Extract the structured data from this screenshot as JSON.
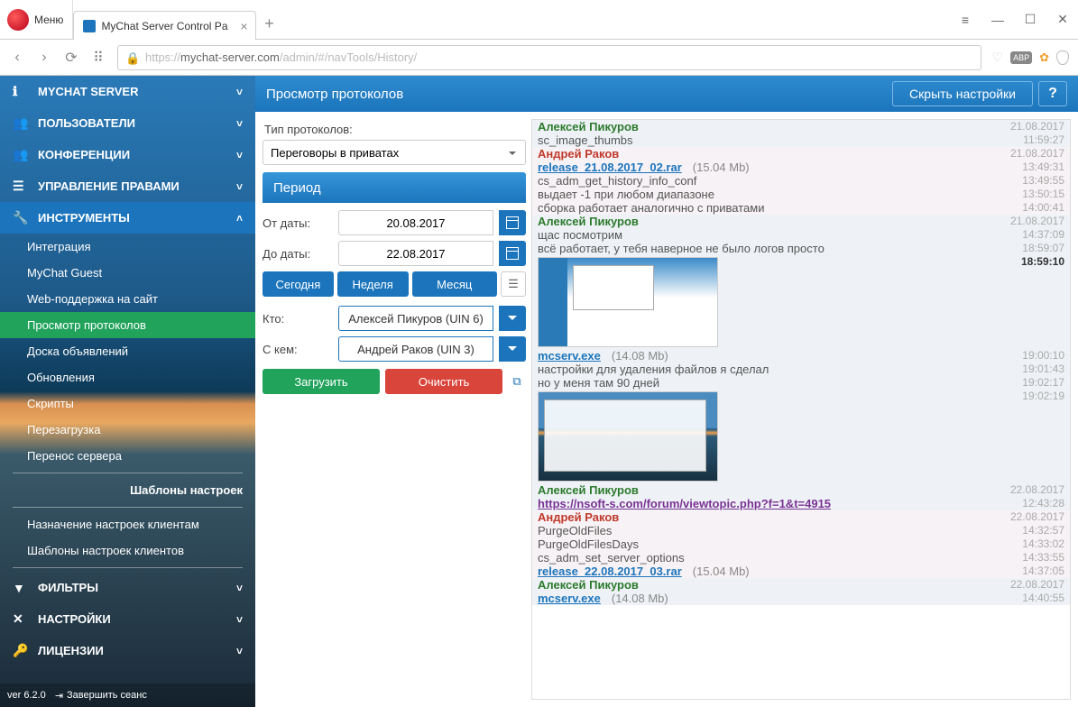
{
  "browser": {
    "menu": "Меню",
    "tab_title": "MyChat Server Control Pa",
    "url_protocol": "https://",
    "url_domain": "mychat-server.com",
    "url_path": "/admin/#/navTools/History/"
  },
  "sidebar": {
    "sections": [
      {
        "label": "MYCHAT SERVER",
        "icon": "ℹ"
      },
      {
        "label": "ПОЛЬЗОВАТЕЛИ",
        "icon": "👥"
      },
      {
        "label": "КОНФЕРЕНЦИИ",
        "icon": "👥"
      },
      {
        "label": "УПРАВЛЕНИЕ ПРАВАМИ",
        "icon": "☰"
      },
      {
        "label": "ИНСТРУМЕНТЫ",
        "icon": "🔧"
      }
    ],
    "tools_items": [
      "Интеграция",
      "MyChat Guest",
      "Web-поддержка на сайт",
      "Просмотр протоколов",
      "Доска объявлений",
      "Обновления",
      "Скрипты",
      "Перезагрузка",
      "Перенос сервера"
    ],
    "templates_header": "Шаблоны настроек",
    "templates_items": [
      "Назначение настроек клиентам",
      "Шаблоны настроек клиентов"
    ],
    "bottom_sections": [
      {
        "label": "ФИЛЬТРЫ",
        "icon": "▼"
      },
      {
        "label": "НАСТРОЙКИ",
        "icon": "✕"
      },
      {
        "label": "ЛИЦЕНЗИИ",
        "icon": "🔑"
      }
    ],
    "version": "ver 6.2.0",
    "logout": "Завершить сеанс"
  },
  "header": {
    "title": "Просмотр протоколов",
    "hide_btn": "Скрыть настройки"
  },
  "settings": {
    "type_label": "Тип протоколов:",
    "type_value": "Переговоры в приватах",
    "period_header": "Период",
    "from_label": "От даты:",
    "from_value": "20.08.2017",
    "to_label": "До даты:",
    "to_value": "22.08.2017",
    "btn_today": "Сегодня",
    "btn_week": "Неделя",
    "btn_month": "Месяц",
    "who_label": "Кто:",
    "who_value": "Алексей Пикуров (UIN 6)",
    "whom_label": "С кем:",
    "whom_value": "Андрей Раков (UIN 3)",
    "btn_load": "Загрузить",
    "btn_clear": "Очистить"
  },
  "chat": {
    "users": {
      "u1": "Алексей Пикуров",
      "u2": "Андрей Раков"
    },
    "blocks": [
      {
        "user": "u1",
        "date": "21.08.2017",
        "cls": "b",
        "lines": [
          {
            "text": "sc_image_thumbs",
            "time": "11:59:27"
          }
        ]
      },
      {
        "user": "u2",
        "date": "21.08.2017",
        "cls": "a",
        "lines": [
          {
            "link": "release_21.08.2017_02.rar",
            "size": "(15.04 Mb)",
            "time": "13:49:31"
          },
          {
            "text": "cs_adm_get_history_info_conf",
            "time": "13:49:55"
          },
          {
            "text": "выдает -1 при любом диапазоне",
            "time": "13:50:15"
          },
          {
            "text": "сборка работает аналогично с приватами",
            "time": "14:00:41"
          }
        ]
      },
      {
        "user": "u1",
        "date": "21.08.2017",
        "cls": "b",
        "lines": [
          {
            "text": "щас посмотрим",
            "time": "14:37:09"
          },
          {
            "text": "всё работает, у тебя наверное не было логов просто",
            "time": "18:59:07"
          },
          {
            "thumb": 1,
            "time": "18:59:10",
            "bold": true
          },
          {
            "link": "mcserv.exe",
            "size": "(14.08 Mb)",
            "time": "19:00:10"
          },
          {
            "text": "настройки для удаления файлов я сделал",
            "time": "19:01:43"
          },
          {
            "text": "но у меня там 90 дней",
            "time": "19:02:17"
          },
          {
            "thumb": 2,
            "time": "19:02:19"
          }
        ]
      },
      {
        "user": "u1",
        "date": "22.08.2017",
        "cls": "b",
        "lines": [
          {
            "link": "https://nsoft-s.com/forum/viewtopic.php?f=1&t=4915",
            "purple": true,
            "time": "12:43:28"
          }
        ]
      },
      {
        "user": "u2",
        "date": "22.08.2017",
        "cls": "a",
        "lines": [
          {
            "text": "PurgeOldFiles",
            "time": "14:32:57"
          },
          {
            "text": "PurgeOldFilesDays",
            "time": "14:33:02"
          },
          {
            "text": "cs_adm_set_server_options",
            "time": "14:33:55"
          },
          {
            "link": "release_22.08.2017_03.rar",
            "size": "(15.04 Mb)",
            "time": "14:37:05"
          }
        ]
      },
      {
        "user": "u1",
        "date": "22.08.2017",
        "cls": "b",
        "lines": [
          {
            "link": "mcserv.exe",
            "size": "(14.08 Mb)",
            "time": "14:40:55"
          }
        ]
      }
    ]
  }
}
